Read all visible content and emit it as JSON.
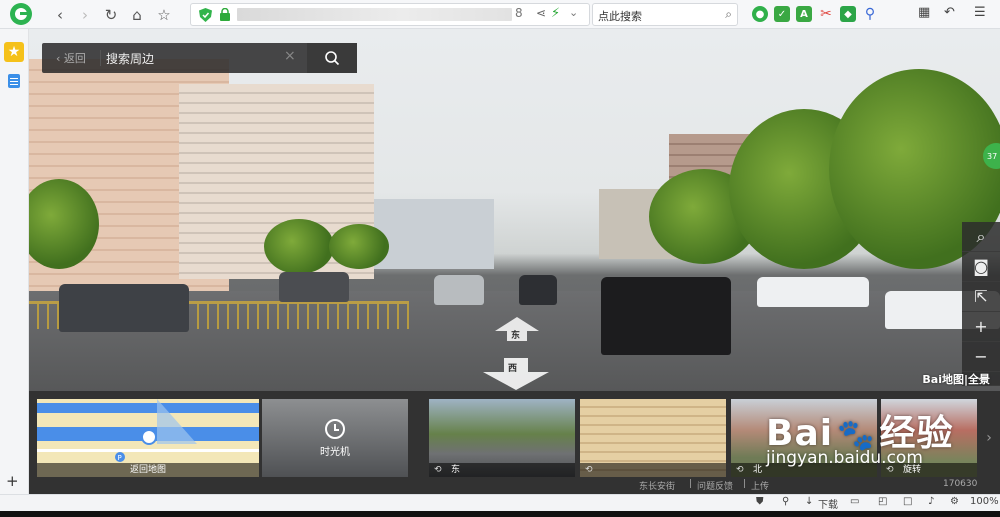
{
  "browser": {
    "url_tail": "8",
    "search_placeholder": "点此搜索",
    "zoom": "100%"
  },
  "map": {
    "back_label": "返回",
    "search_placeholder": "搜索周边",
    "forward_arrow_label": "东",
    "back_arrow_label": "西",
    "badge_value": "37",
    "brand": "Bai地图|全景"
  },
  "strip": {
    "thumbs": [
      {
        "caption": "返回地图"
      },
      {
        "caption": "时光机"
      },
      {
        "caption": "东"
      },
      {
        "caption": ""
      },
      {
        "caption": "北"
      },
      {
        "caption": "旋转"
      }
    ],
    "footer": {
      "location": "东长安街",
      "feedback": "问题反馈",
      "upload": "上传",
      "date": "170630"
    }
  },
  "watermark": {
    "brand": "Bai",
    "cn": "经验",
    "url": "jingyan.baidu.com"
  },
  "statusbar": {
    "download": "下载",
    "zoom": "100%"
  }
}
